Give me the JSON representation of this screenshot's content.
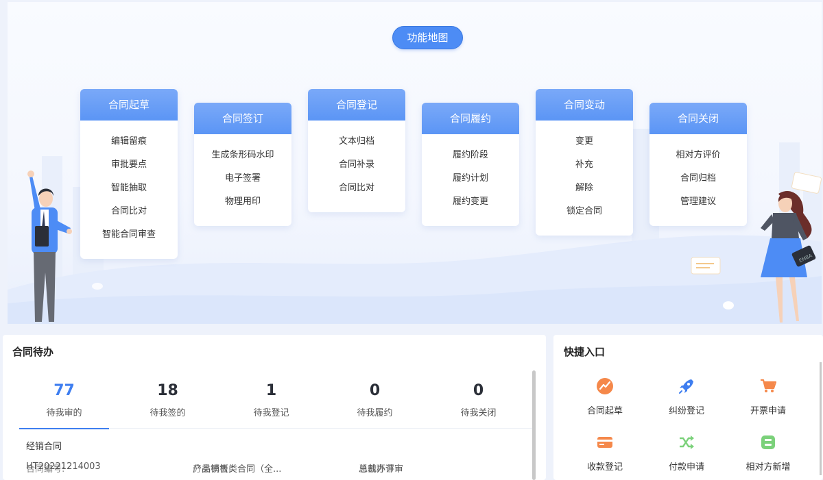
{
  "map": {
    "title": "功能地图",
    "stages": [
      {
        "title": "合同起草",
        "items": [
          "编辑留痕",
          "审批要点",
          "智能抽取",
          "合同比对",
          "智能合同审查"
        ]
      },
      {
        "title": "合同签订",
        "items": [
          "生成条形码水印",
          "电子签署",
          "物理用印"
        ]
      },
      {
        "title": "合同登记",
        "items": [
          "文本归档",
          "合同补录",
          "合同比对"
        ]
      },
      {
        "title": "合同履约",
        "items": [
          "履约阶段",
          "履约计划",
          "履约变更"
        ]
      },
      {
        "title": "合同变动",
        "items": [
          "变更",
          "补充",
          "解除",
          "锁定合同"
        ]
      },
      {
        "title": "合同关闭",
        "items": [
          "相对方评价",
          "合同归档",
          "管理建议"
        ]
      }
    ],
    "badge_text": "EMBA"
  },
  "todo": {
    "title": "合同待办",
    "stats": [
      {
        "num": "77",
        "label": "待我审的"
      },
      {
        "num": "18",
        "label": "待我签的"
      },
      {
        "num": "1",
        "label": "待我登记"
      },
      {
        "num": "0",
        "label": "待我履约"
      },
      {
        "num": "0",
        "label": "待我关闭"
      }
    ],
    "active_tab": 0,
    "row": {
      "title": "经销合同",
      "no_label": "合同编号:",
      "no_value": "HT20221214003",
      "tpl_label": "分类模板:",
      "tpl_value": "产品销售类合同（全...",
      "step_label": "当前环节:",
      "step_value": "总裁办评审"
    }
  },
  "quick": {
    "title": "快捷入口",
    "items": [
      {
        "label": "合同起草",
        "icon": "draft-chart-icon",
        "color": "#f5884a"
      },
      {
        "label": "纠纷登记",
        "icon": "rocket-icon",
        "color": "#3f7ef0"
      },
      {
        "label": "开票申请",
        "icon": "cart-icon",
        "color": "#f5884a"
      },
      {
        "label": "收款登记",
        "icon": "card-icon",
        "color": "#f5884a"
      },
      {
        "label": "付款申请",
        "icon": "shuffle-icon",
        "color": "#7bd17a"
      },
      {
        "label": "相对方新增",
        "icon": "counterparty-icon",
        "color": "#7bd17a"
      }
    ]
  }
}
